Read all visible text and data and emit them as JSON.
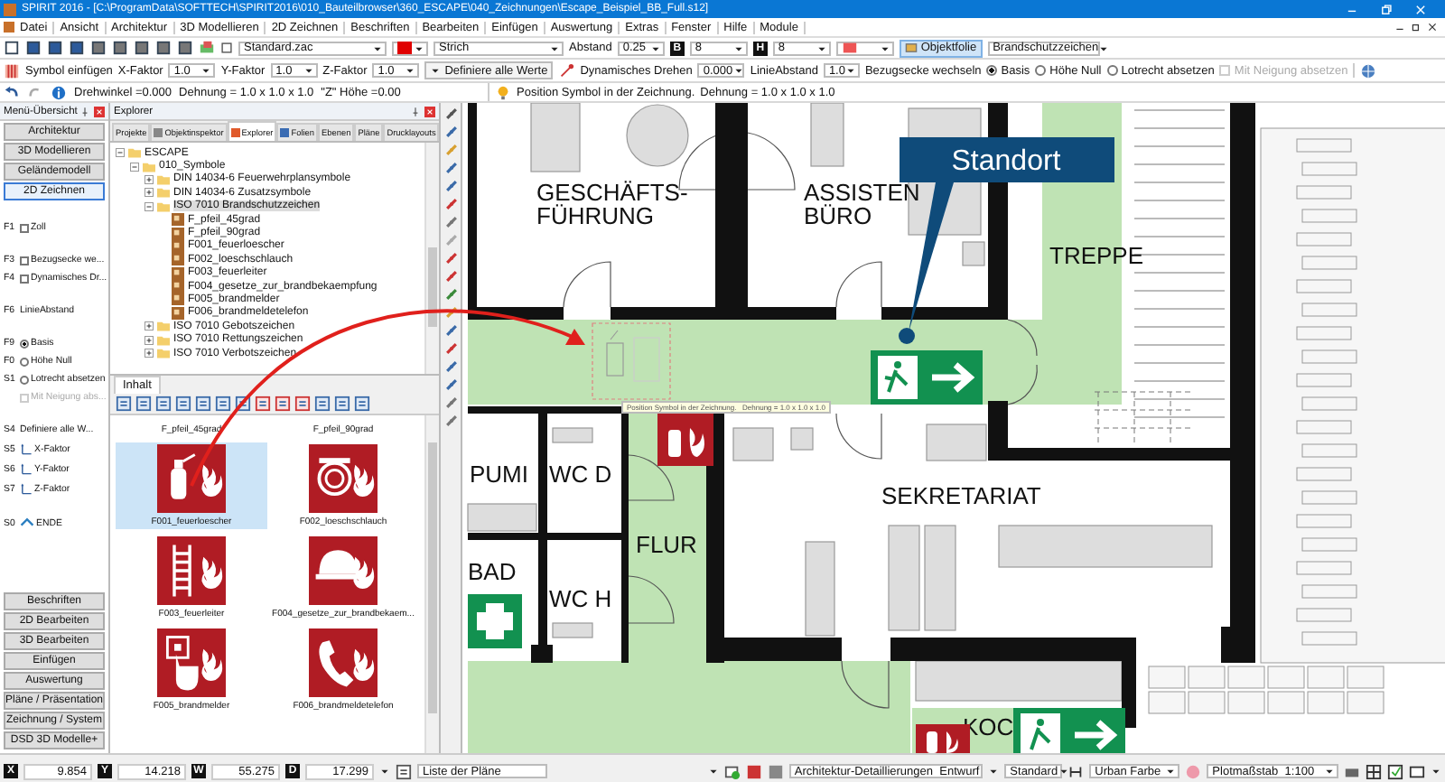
{
  "window": {
    "title": "SPIRIT 2016 - [C:\\ProgramData\\SOFTTECH\\SPIRIT2016\\010_Bauteilbrowser\\360_ESCAPE\\040_Zeichnungen\\Escape_Beispiel_BB_Full.s12]"
  },
  "menu": [
    "Datei",
    "Ansicht",
    "Architektur",
    "3D Modellieren",
    "2D Zeichnen",
    "Beschriften",
    "Bearbeiten",
    "Einfügen",
    "Auswertung",
    "Extras",
    "Fenster",
    "Hilfe",
    "Module"
  ],
  "toolbar": {
    "style_file": "Standard.zac",
    "line_type": "Strich",
    "spacing_label": "Abstand",
    "spacing": "0.25",
    "b_key": "B",
    "b_value": "8",
    "h_key": "H",
    "h_value": "8",
    "layer_button": "Objektfolie",
    "layer": "Brandschutzzeichen"
  },
  "symbol_bar": {
    "title": "Symbol einfügen",
    "fields": [
      {
        "label": "X-Faktor",
        "value": "1.0"
      },
      {
        "label": "Y-Faktor",
        "value": "1.0"
      },
      {
        "label": "Z-Faktor",
        "value": "1.0"
      }
    ],
    "define_all": "Definiere alle Werte",
    "rotate_label": "Dynamisches Drehen",
    "rotate": "0.000",
    "line_spacing_label": "LinieAbstand",
    "line_spacing": "1.0",
    "corner_label": "Bezugsecke wechseln",
    "options": [
      {
        "kind": "radio",
        "label": "Basis",
        "selected": true,
        "disabled": false
      },
      {
        "kind": "radio",
        "label": "Höhe Null",
        "selected": false,
        "disabled": false
      },
      {
        "kind": "radio",
        "label": "Lotrecht absetzen",
        "selected": false,
        "disabled": false
      },
      {
        "kind": "checkbox",
        "label": "Mit Neigung absetzen",
        "selected": false,
        "disabled": true
      }
    ]
  },
  "info_bar": {
    "rotation": "Drehwinkel =0.000",
    "stretch": "Dehnung = 1.0 x 1.0 x 1.0",
    "height": "\"Z\" Höhe =0.00",
    "prompt": "Position Symbol in der Zeichnung.",
    "scale": "Dehnung = 1.0 x 1.0 x 1.0"
  },
  "menu_overview": {
    "title": "Menü-Übersicht",
    "top_buttons": [
      {
        "label": "Architektur",
        "selected": false
      },
      {
        "label": "3D Modellieren",
        "selected": false
      },
      {
        "label": "Geländemodell",
        "selected": false
      },
      {
        "label": "2D Zeichnen",
        "selected": true
      }
    ],
    "groups": [
      {
        "items": [
          {
            "key": "F1",
            "kind": "checkbox",
            "label": "Zoll",
            "selected": false,
            "disabled": false
          }
        ]
      },
      {
        "items": [
          {
            "key": "F3",
            "kind": "checkbox",
            "label": "Bezugsecke we...",
            "selected": false,
            "disabled": false
          },
          {
            "key": "F4",
            "kind": "checkbox",
            "label": "Dynamisches Dr...",
            "selected": false,
            "disabled": false
          }
        ]
      },
      {
        "items": [
          {
            "key": "F6",
            "kind": "text",
            "label": "LinieAbstand",
            "disabled": false
          }
        ]
      },
      {
        "items": [
          {
            "key": "F9",
            "kind": "radio",
            "label": "Basis",
            "selected": true,
            "disabled": false
          },
          {
            "key": "F0",
            "kind": "radio",
            "label": "Höhe Null",
            "selected": false,
            "disabled": false
          },
          {
            "key": "S1",
            "kind": "radio",
            "label": "Lotrecht absetzen",
            "selected": false,
            "disabled": false
          },
          {
            "kind": "checkbox",
            "label": "Mit Neigung abs...",
            "selected": false,
            "disabled": true
          }
        ]
      },
      {
        "items": [
          {
            "key": "S4",
            "kind": "text",
            "label": "Definiere alle W...",
            "disabled": false
          },
          {
            "key": "S5",
            "kind": "axis",
            "label": "X-Faktor",
            "disabled": false
          },
          {
            "key": "S6",
            "kind": "axis",
            "label": "Y-Faktor",
            "disabled": false
          },
          {
            "key": "S7",
            "kind": "axis",
            "label": "Z-Faktor",
            "disabled": false
          }
        ]
      },
      {
        "items": [
          {
            "key": "S0",
            "kind": "exit",
            "label": "ENDE",
            "disabled": false
          }
        ]
      }
    ],
    "bottom_buttons": [
      "Beschriften",
      "2D Bearbeiten",
      "3D Bearbeiten",
      "Einfügen",
      "Auswertung",
      "Pläne / Präsentation",
      "Zeichnung / System",
      "DSD 3D Modelle+"
    ]
  },
  "explorer": {
    "title": "Explorer",
    "tabs": [
      {
        "label": "Projekte",
        "selected": false
      },
      {
        "label": "Objektinspektor",
        "selected": false
      },
      {
        "label": "Explorer",
        "selected": true
      },
      {
        "label": "Folien",
        "selected": false
      },
      {
        "label": "Ebenen",
        "selected": false
      },
      {
        "label": "Pläne",
        "selected": false
      },
      {
        "label": "Drucklayouts",
        "selected": false
      }
    ],
    "tree": [
      {
        "label": "ESCAPE",
        "kind": "folder",
        "expanded": true,
        "selected": false,
        "children": [
          {
            "label": "010_Symbole",
            "kind": "folder",
            "expanded": true,
            "selected": false,
            "children": [
              {
                "label": "DIN 14034-6 Feuerwehrplansymbole",
                "kind": "folder",
                "expanded": false,
                "selected": false
              },
              {
                "label": "DIN 14034-6 Zusatzsymbole",
                "kind": "folder",
                "expanded": false,
                "selected": false
              },
              {
                "label": "ISO 7010 Brandschutzzeichen",
                "kind": "folder",
                "expanded": true,
                "selected": true,
                "children": [
                  {
                    "label": "F_pfeil_45grad",
                    "kind": "symbol",
                    "selected": false
                  },
                  {
                    "label": "F_pfeil_90grad",
                    "kind": "symbol",
                    "selected": false
                  },
                  {
                    "label": "F001_feuerloescher",
                    "kind": "symbol",
                    "selected": false
                  },
                  {
                    "label": "F002_loeschschlauch",
                    "kind": "symbol",
                    "selected": false
                  },
                  {
                    "label": "F003_feuerleiter",
                    "kind": "symbol",
                    "selected": false
                  },
                  {
                    "label": "F004_gesetze_zur_brandbekaempfung",
                    "kind": "symbol",
                    "selected": false
                  },
                  {
                    "label": "F005_brandmelder",
                    "kind": "symbol",
                    "selected": false
                  },
                  {
                    "label": "F006_brandmeldetelefon",
                    "kind": "symbol",
                    "selected": false
                  }
                ]
              },
              {
                "label": "ISO 7010 Gebotszeichen",
                "kind": "folder",
                "expanded": false,
                "selected": false
              },
              {
                "label": "ISO 7010 Rettungszeichen",
                "kind": "folder",
                "expanded": false,
                "selected": false
              },
              {
                "label": "ISO 7010 Verbotszeichen",
                "kind": "folder",
                "expanded": false,
                "selected": false
              }
            ]
          }
        ]
      }
    ],
    "content_tab": "Inhalt",
    "tiles": [
      {
        "label": "F_pfeil_45grad",
        "kind": "none",
        "selected": false
      },
      {
        "label": "F_pfeil_90grad",
        "kind": "none",
        "selected": false
      },
      {
        "label": "F001_feuerloescher",
        "kind": "extinguisher",
        "selected": true
      },
      {
        "label": "F002_loeschschlauch",
        "kind": "hose",
        "selected": false
      },
      {
        "label": "F003_feuerleiter",
        "kind": "ladder",
        "selected": false
      },
      {
        "label": "F004_gesetze_zur_brandbekaem...",
        "kind": "equipment",
        "selected": false
      },
      {
        "label": "F005_brandmelder",
        "kind": "call-point",
        "selected": false
      },
      {
        "label": "F006_brandmeldetelefon",
        "kind": "phone",
        "selected": false
      }
    ]
  },
  "floor_plan": {
    "rooms": [
      {
        "lines": [
          "GESCHÄFTS-",
          "FÜHRUNG"
        ]
      },
      {
        "lines": [
          "ASSISTEN",
          "BÜRO"
        ]
      },
      {
        "lines": [
          "TREPPE"
        ]
      },
      {
        "lines": [
          "PUMI"
        ]
      },
      {
        "lines": [
          "WC D"
        ]
      },
      {
        "lines": [
          "BAD"
        ]
      },
      {
        "lines": [
          "WC H"
        ]
      },
      {
        "lines": [
          "FLUR"
        ]
      },
      {
        "lines": [
          "SEKRETARIAT"
        ]
      },
      {
        "lines": [
          "KOC"
        ]
      }
    ],
    "callout": "Standort",
    "tooltip": "Position Symbol in der Zeichnung.   Dehnung = 1.0 x 1.0 x 1.0"
  },
  "status_bar": {
    "coords": [
      {
        "key": "X",
        "value": "9.854"
      },
      {
        "key": "Y",
        "value": "14.218"
      },
      {
        "key": "W",
        "value": "55.275"
      },
      {
        "key": "D",
        "value": "17.299"
      }
    ],
    "plans": "Liste der Pläne",
    "detail_label": "Architektur-Detaillierungen",
    "detail": "Entwurf",
    "style": "Standard",
    "colors": "Urban Farbe",
    "plot_label": "Plotmaßstab",
    "plot": "1:100"
  }
}
